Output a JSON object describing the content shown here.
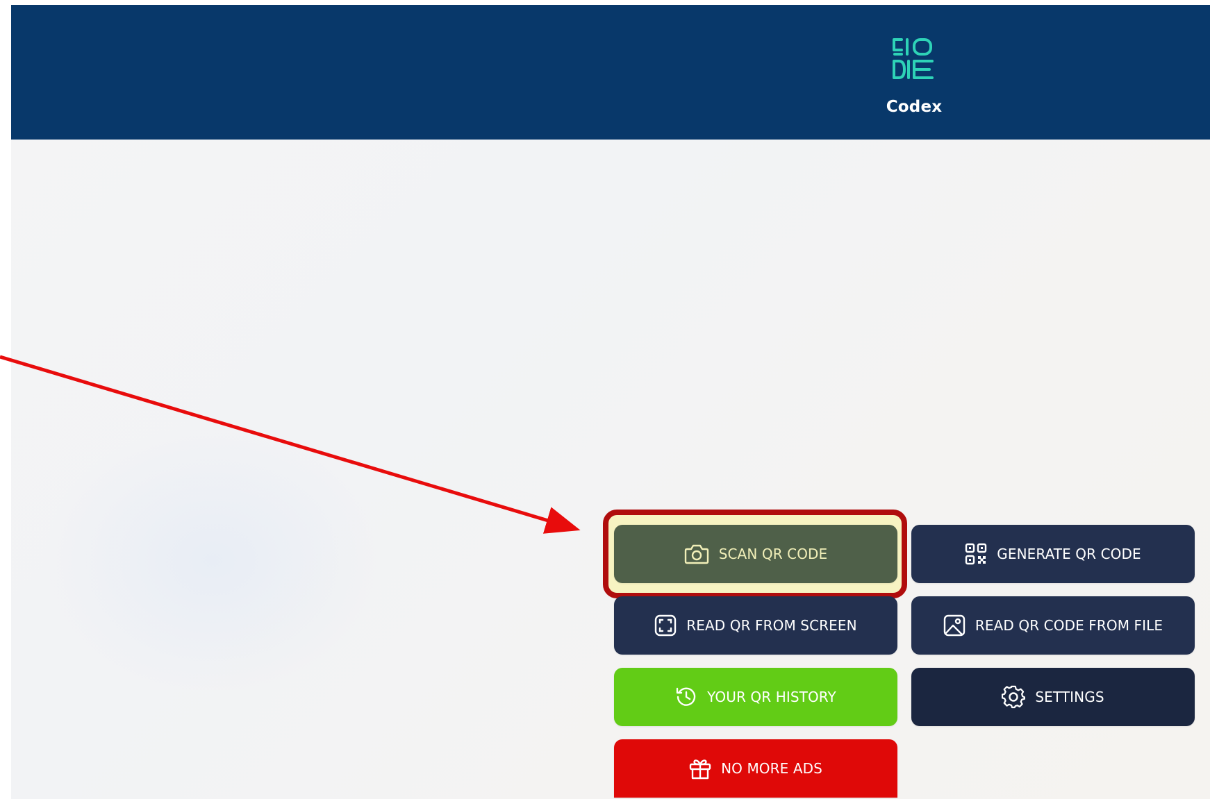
{
  "app": {
    "name": "Codex",
    "logo_lines": [
      "CIO",
      "DIE"
    ]
  },
  "buttons": {
    "scan": "SCAN QR CODE",
    "generate": "GENERATE QR CODE",
    "read_screen": "READ QR FROM SCREEN",
    "read_file": "READ QR CODE FROM FILE",
    "history": "YOUR QR HISTORY",
    "settings": "SETTINGS",
    "no_ads": "NO MORE ADS"
  },
  "icons": {
    "scan": "camera-icon",
    "generate": "qr-code-icon",
    "read_screen": "screen-capture-icon",
    "read_file": "image-file-icon",
    "history": "history-icon",
    "settings": "gear-icon",
    "no_ads": "gift-icon"
  },
  "colors": {
    "header": "#08386a",
    "logo_accent": "#2ed3b7",
    "button_dark": "#23304f",
    "button_settings": "#1b2640",
    "button_history": "#62cc16",
    "button_ads": "#df0908",
    "button_scan": "#4f6049",
    "annotation": "#e80c0c"
  }
}
